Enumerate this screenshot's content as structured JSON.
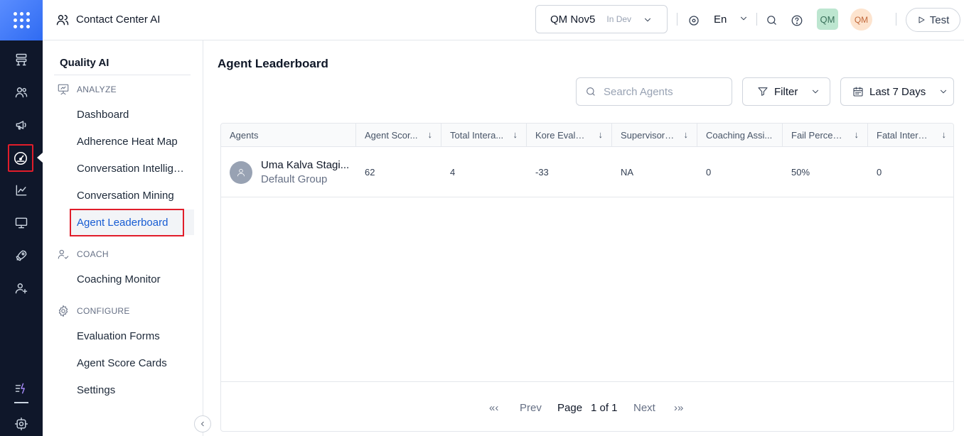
{
  "header": {
    "app_title": "Contact Center AI",
    "environment": {
      "name": "QM Nov5",
      "status": "In Dev"
    },
    "language": "En",
    "avatar_primary": "QM",
    "avatar_secondary": "QM",
    "test_label": "Test"
  },
  "rail": {
    "items": [
      "flow-icon",
      "users-icon",
      "megaphone-icon",
      "gauge-icon",
      "chart-icon",
      "monitor-icon",
      "rocket-icon",
      "add-user-icon",
      "lightning-list-icon",
      "settings-icon"
    ],
    "active": "gauge-icon"
  },
  "sidebar": {
    "title": "Quality AI",
    "sections": [
      {
        "label": "ANALYZE",
        "items": [
          "Dashboard",
          "Adherence Heat Map",
          "Conversation Intelligence",
          "Conversation Mining",
          "Agent Leaderboard"
        ]
      },
      {
        "label": "COACH",
        "items": [
          "Coaching Monitor"
        ]
      },
      {
        "label": "CONFIGURE",
        "items": [
          "Evaluation Forms",
          "Agent Score Cards",
          "Settings"
        ]
      }
    ],
    "active_item": "Agent Leaderboard"
  },
  "main": {
    "title": "Agent Leaderboard",
    "search_placeholder": "Search Agents",
    "filter_label": "Filter",
    "date_range": "Last 7 Days",
    "table": {
      "columns": [
        "Agents",
        "Agent Score",
        "Total Interactions",
        "Kore Evaluation",
        "Supervisor Audit",
        "Coaching Assignments",
        "Fail Percentage",
        "Fatal Interactions"
      ],
      "column_display": [
        "Agents",
        "Agent Scor...",
        "Total Intera...",
        "Kore Evalua...",
        "Supervisor ...",
        "Coaching Assi...",
        "Fail Percen...",
        "Fatal Intera..."
      ],
      "rows": [
        {
          "agent_name": "Uma Kalva Stagi...",
          "agent_group": "Default Group",
          "cells": [
            "62",
            "4",
            "-33",
            "NA",
            "0",
            "50%",
            "0"
          ]
        }
      ]
    },
    "pagination": {
      "first": "«‹",
      "prev": "Prev",
      "page_label": "Page",
      "page_value": "1 of 1",
      "next": "Next",
      "last": "›»"
    }
  }
}
